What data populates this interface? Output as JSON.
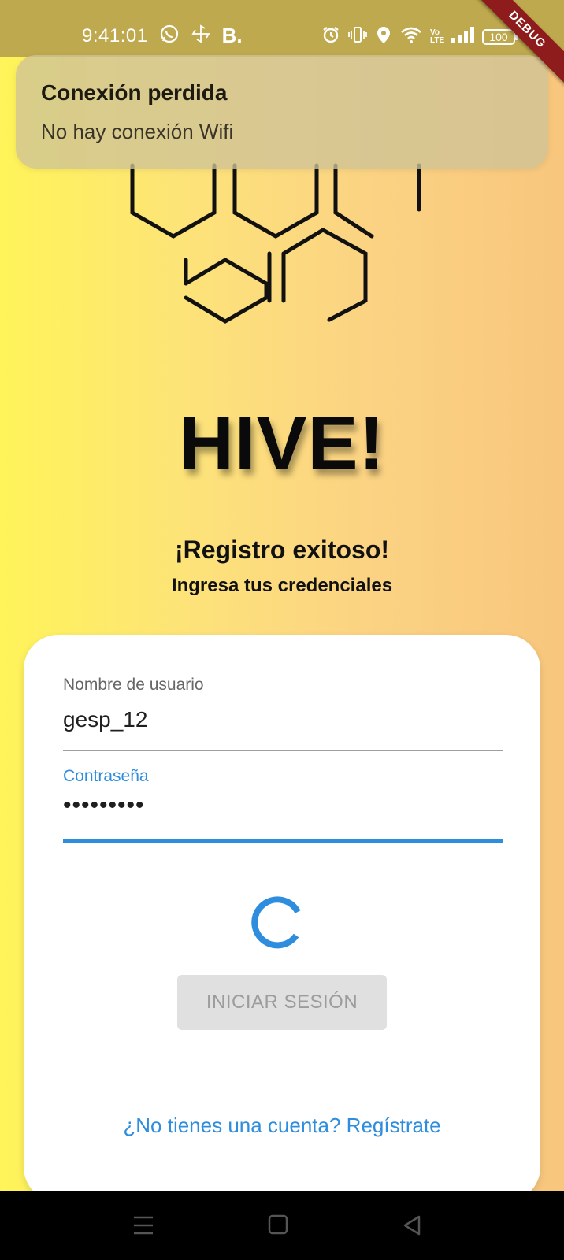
{
  "status_bar": {
    "time": "9:41:01",
    "b_label": "B.",
    "battery": "100",
    "volte": "Vo LTE"
  },
  "debug_banner": "DEBUG",
  "notification": {
    "title": "Conexión perdida",
    "body": "No hay conexión Wifi"
  },
  "app": {
    "title": "HIVE!",
    "success_title": "¡Registro exitoso!",
    "success_subtitle": "Ingresa tus credenciales"
  },
  "form": {
    "username_label": "Nombre de usuario",
    "username_value": "gesp_12",
    "password_label": "Contraseña",
    "password_value": "•••••••••",
    "login_button": "INICIAR SESIÓN",
    "register_link": "¿No tienes una cuenta? Regístrate"
  },
  "colors": {
    "accent": "#2f8dde",
    "ribbon": "#8e1c1c",
    "status_bar": "#bfa94f"
  },
  "icons": [
    "whatsapp-icon",
    "settings-pinwheel-icon",
    "alarm-icon",
    "vibrate-icon",
    "location-icon",
    "wifi-icon",
    "signal-icon",
    "battery-icon",
    "menu-icon",
    "home-icon",
    "back-icon"
  ]
}
